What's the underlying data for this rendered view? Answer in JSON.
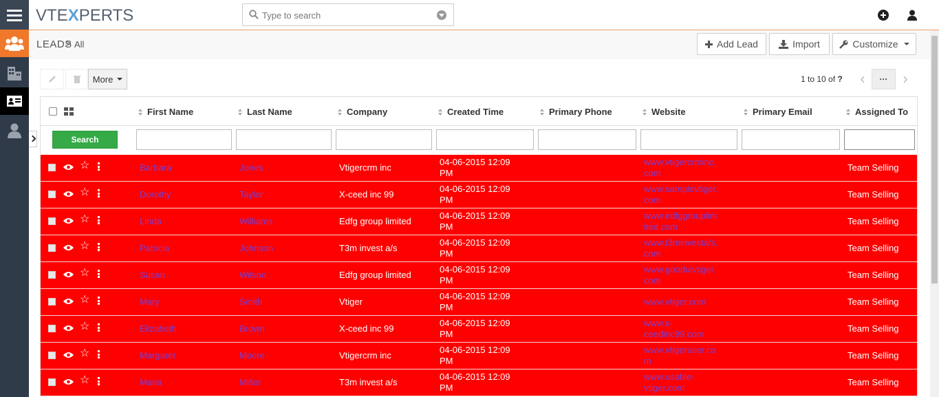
{
  "app": {
    "logo_prefix": "VTE",
    "logo_x": "X",
    "logo_suffix": "PERTS"
  },
  "search": {
    "placeholder": "Type to search"
  },
  "rail": [
    "menu-icon",
    "leads-icon",
    "organizations-icon",
    "contacts-icon",
    "users-icon"
  ],
  "breadcrumb": {
    "module": "LEADS",
    "separator": ">",
    "view": "All"
  },
  "header_buttons": {
    "add": "Add Lead",
    "import": "Import",
    "customize": "Customize"
  },
  "actions": {
    "more": "More"
  },
  "pager": {
    "range": "1 to 10",
    "of": "of",
    "total": "?",
    "more": "···"
  },
  "columns": [
    "First Name",
    "Last Name",
    "Company",
    "Created Time",
    "Primary Phone",
    "Website",
    "Primary Email",
    "Assigned To"
  ],
  "filters": {
    "search_label": "Search"
  },
  "rows": [
    {
      "first": "Barbara",
      "last": "Jones",
      "company": "Vtigercrm inc",
      "created1": "04-06-2015 12:09",
      "created2": "PM",
      "phone": "",
      "web1": "www.vtigercrminc.",
      "web2": "com",
      "email": "",
      "assigned": "Team Selling"
    },
    {
      "first": "Dorothy",
      "last": "Taylor",
      "company": "X-ceed inc 99",
      "created1": "04-06-2015 12:09",
      "created2": "PM",
      "phone": "",
      "web1": "www.samplevtiger.",
      "web2": "com",
      "email": "",
      "assigned": "Team Selling"
    },
    {
      "first": "Linda",
      "last": "Williams",
      "company": "Edfg group limited",
      "created1": "04-06-2015 12:09",
      "created2": "PM",
      "phone": "",
      "web1": "www.edfggrouplim",
      "web2": "ited.com",
      "email": "",
      "assigned": "Team Selling"
    },
    {
      "first": "Patricia",
      "last": "Johnson",
      "company": "T3m invest a/s",
      "created1": "04-06-2015 12:09",
      "created2": "PM",
      "phone": "",
      "web1": "www.t3minvesta/s.",
      "web2": "com",
      "email": "",
      "assigned": "Team Selling"
    },
    {
      "first": "Susan",
      "last": "Wilson",
      "company": "Edfg group limited",
      "created1": "04-06-2015 12:09",
      "created2": "PM",
      "phone": "",
      "web1": "www.gooduivtiger.",
      "web2": "com",
      "email": "",
      "assigned": "Team Selling"
    },
    {
      "first": "Mary",
      "last": "Smith",
      "company": "Vtiger",
      "created1": "04-06-2015 12:09",
      "created2": "PM",
      "phone": "",
      "web1": "www.vtiger.com",
      "web2": "",
      "email": "",
      "assigned": "Team Selling"
    },
    {
      "first": "Elizabeth",
      "last": "Brown",
      "company": "X-ceed inc 99",
      "created1": "04-06-2015 12:09",
      "created2": "PM",
      "phone": "",
      "web1": "www.x-",
      "web2": "ceedinc99.com",
      "email": "",
      "assigned": "Team Selling"
    },
    {
      "first": "Margaret",
      "last": "Moore",
      "company": "Vtigercrm inc",
      "created1": "04-06-2015 12:09",
      "created2": "PM",
      "phone": "",
      "web1": "www.vtigeruser.co",
      "web2": "m",
      "email": "",
      "assigned": "Team Selling"
    },
    {
      "first": "Maria",
      "last": "Miller",
      "company": "T3m invest a/s",
      "created1": "04-06-2015 12:09",
      "created2": "PM",
      "phone": "",
      "web1": "www.usable-",
      "web2": "vtiger.com",
      "email": "",
      "assigned": "Team Selling"
    }
  ],
  "colors": {
    "row_highlight": "#ff0000",
    "link": "#7b3fcf",
    "accent": "#f0782a",
    "rail": "#2f3b48",
    "search_button": "#35aa47"
  }
}
